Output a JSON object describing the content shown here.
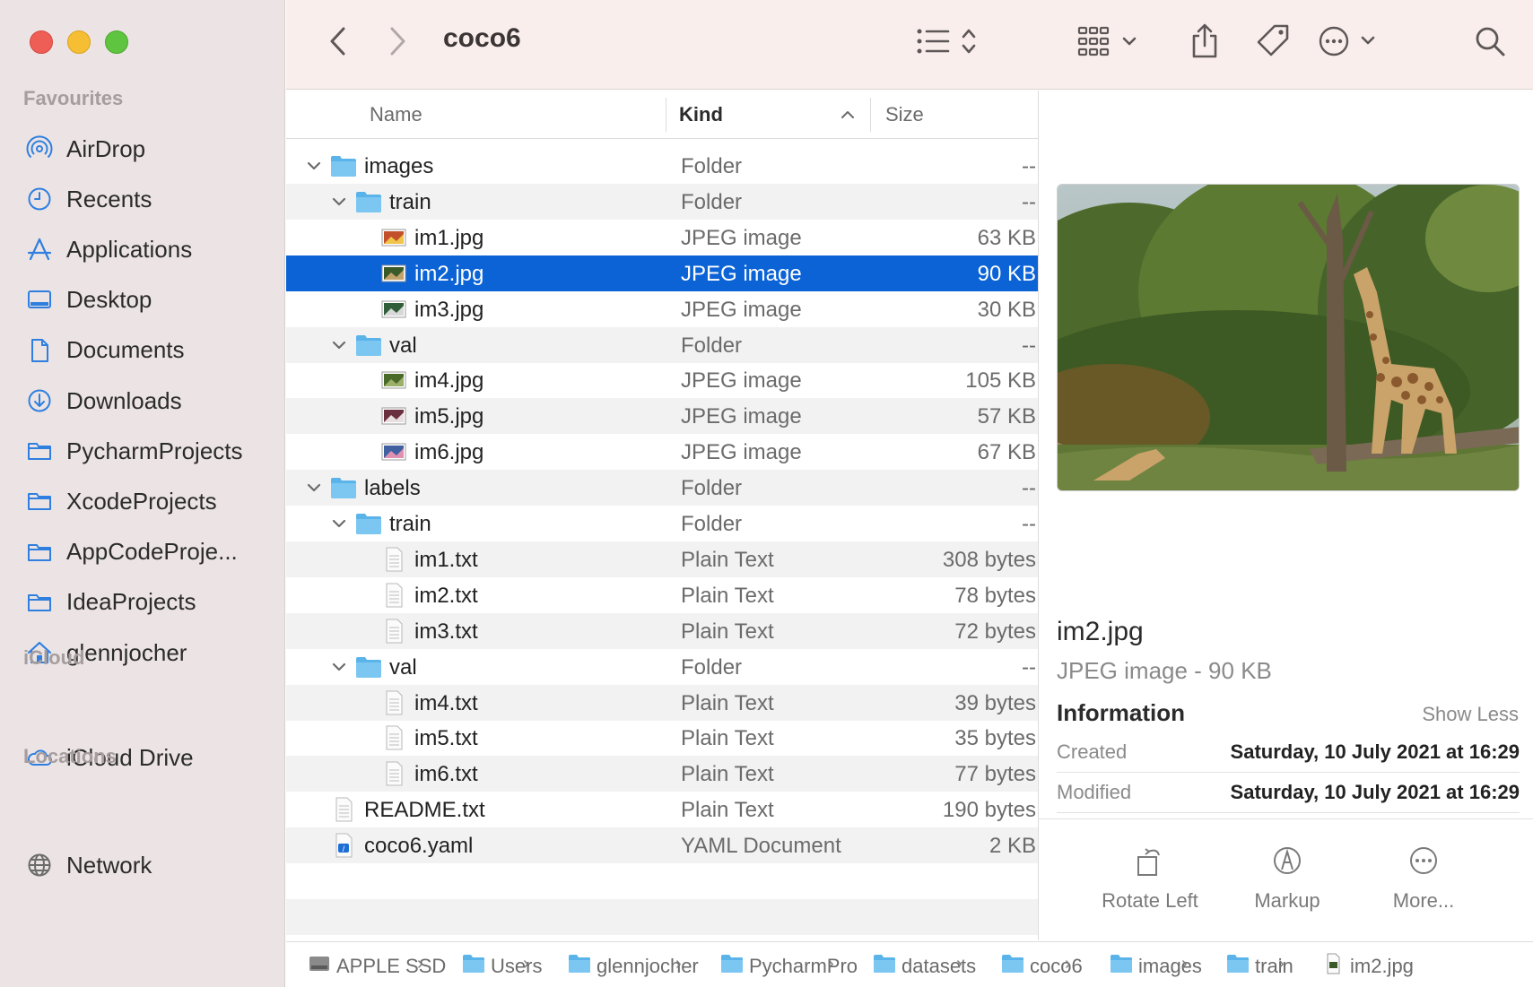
{
  "window": {
    "title": "coco6"
  },
  "sidebar": {
    "favourites_label": "Favourites",
    "favourites": [
      {
        "label": "AirDrop",
        "icon": "airdrop-icon"
      },
      {
        "label": "Recents",
        "icon": "clock-icon"
      },
      {
        "label": "Applications",
        "icon": "applications-icon"
      },
      {
        "label": "Desktop",
        "icon": "desktop-icon"
      },
      {
        "label": "Documents",
        "icon": "document-icon"
      },
      {
        "label": "Downloads",
        "icon": "download-icon"
      },
      {
        "label": "PycharmProjects",
        "icon": "folder-icon"
      },
      {
        "label": "XcodeProjects",
        "icon": "folder-icon"
      },
      {
        "label": "AppCodeProje...",
        "icon": "folder-icon"
      },
      {
        "label": "IdeaProjects",
        "icon": "folder-icon"
      },
      {
        "label": "glennjocher",
        "icon": "home-icon"
      }
    ],
    "icloud_label": "iCloud",
    "icloud": [
      {
        "label": "iCloud Drive",
        "icon": "cloud-icon"
      }
    ],
    "locations_label": "Locations",
    "locations": [
      {
        "label": "Network",
        "icon": "globe-icon"
      }
    ]
  },
  "columns": {
    "name": "Name",
    "kind": "Kind",
    "size": "Size"
  },
  "files": [
    {
      "name": "images",
      "kind": "Folder",
      "size": "--",
      "level": 0,
      "type": "folder",
      "expanded": true
    },
    {
      "name": "train",
      "kind": "Folder",
      "size": "--",
      "level": 1,
      "type": "folder",
      "expanded": true
    },
    {
      "name": "im1.jpg",
      "kind": "JPEG image",
      "size": "63 KB",
      "level": 2,
      "type": "image"
    },
    {
      "name": "im2.jpg",
      "kind": "JPEG image",
      "size": "90 KB",
      "level": 2,
      "type": "image",
      "selected": true
    },
    {
      "name": "im3.jpg",
      "kind": "JPEG image",
      "size": "30 KB",
      "level": 2,
      "type": "image"
    },
    {
      "name": "val",
      "kind": "Folder",
      "size": "--",
      "level": 1,
      "type": "folder",
      "expanded": true
    },
    {
      "name": "im4.jpg",
      "kind": "JPEG image",
      "size": "105 KB",
      "level": 2,
      "type": "image"
    },
    {
      "name": "im5.jpg",
      "kind": "JPEG image",
      "size": "57 KB",
      "level": 2,
      "type": "image"
    },
    {
      "name": "im6.jpg",
      "kind": "JPEG image",
      "size": "67 KB",
      "level": 2,
      "type": "image"
    },
    {
      "name": "labels",
      "kind": "Folder",
      "size": "--",
      "level": 0,
      "type": "folder",
      "expanded": true
    },
    {
      "name": "train",
      "kind": "Folder",
      "size": "--",
      "level": 1,
      "type": "folder",
      "expanded": true
    },
    {
      "name": "im1.txt",
      "kind": "Plain Text",
      "size": "308 bytes",
      "level": 2,
      "type": "text"
    },
    {
      "name": "im2.txt",
      "kind": "Plain Text",
      "size": "78 bytes",
      "level": 2,
      "type": "text"
    },
    {
      "name": "im3.txt",
      "kind": "Plain Text",
      "size": "72 bytes",
      "level": 2,
      "type": "text"
    },
    {
      "name": "val",
      "kind": "Folder",
      "size": "--",
      "level": 1,
      "type": "folder",
      "expanded": true
    },
    {
      "name": "im4.txt",
      "kind": "Plain Text",
      "size": "39 bytes",
      "level": 2,
      "type": "text"
    },
    {
      "name": "im5.txt",
      "kind": "Plain Text",
      "size": "35 bytes",
      "level": 2,
      "type": "text"
    },
    {
      "name": "im6.txt",
      "kind": "Plain Text",
      "size": "77 bytes",
      "level": 2,
      "type": "text"
    },
    {
      "name": "README.txt",
      "kind": "Plain Text",
      "size": "190 bytes",
      "level": 0,
      "type": "text"
    },
    {
      "name": "coco6.yaml",
      "kind": "YAML Document",
      "size": "2 KB",
      "level": 0,
      "type": "yaml"
    }
  ],
  "preview": {
    "name": "im2.jpg",
    "kind": "JPEG image - 90 KB",
    "information_label": "Information",
    "show_less": "Show Less",
    "created_label": "Created",
    "created_value": "Saturday, 10 July 2021 at 16:29",
    "modified_label": "Modified",
    "modified_value": "Saturday, 10 July 2021 at 16:29",
    "actions": [
      {
        "label": "Rotate Left",
        "icon": "rotate-left-icon"
      },
      {
        "label": "Markup",
        "icon": "markup-icon"
      },
      {
        "label": "More...",
        "icon": "more-icon"
      }
    ]
  },
  "path": [
    "APPLE SSD",
    "Users",
    "glennjocher",
    "PycharmPro",
    "datasets",
    "coco6",
    "images",
    "train",
    "im2.jpg"
  ],
  "colors": {
    "selection": "#0b63d6",
    "folder": "#5ab4ea",
    "sidebar_icon": "#2f7fe0"
  }
}
